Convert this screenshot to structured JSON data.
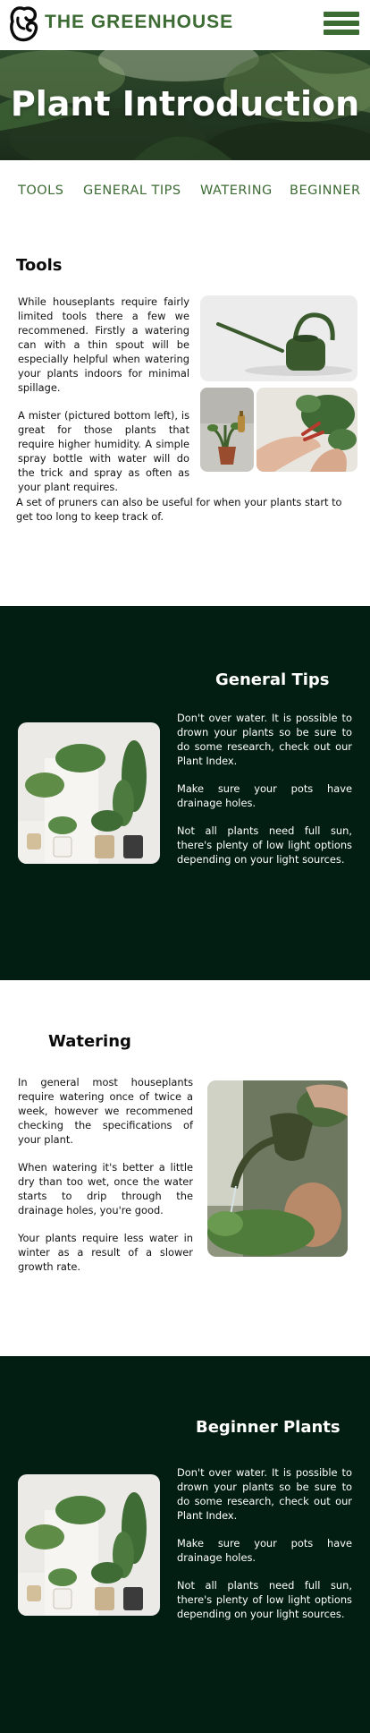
{
  "header": {
    "brand": "THE GREENHOUSE",
    "logo_icon": "greenhouse-logo-icon",
    "menu_icon": "hamburger-menu-icon"
  },
  "hero": {
    "title": "Plant Introduction"
  },
  "nav": {
    "items": [
      {
        "label": "TOOLS"
      },
      {
        "label": "GENERAL TIPS"
      },
      {
        "label": "WATERING"
      },
      {
        "label": "BEGINNER"
      }
    ]
  },
  "tools": {
    "title": "Tools",
    "paragraphs": [
      "While houseplants require fairly limited tools there a few we recommened. Firstly a watering can with a thin spout will be especially helpful when watering your plants indoors for minimal spillage.",
      "A mister (pictured bottom left), is great for those plants that require higher humidity. A simple spray bottle with water will do the trick and spray as often as your plant requires.",
      "A set of pruners can also be useful for when your plants start to get too long to keep track of."
    ]
  },
  "general_tips": {
    "title": "General Tips",
    "paragraphs": [
      "Don't over water. It is possible to drown your plants so be sure to do some research, check out our Plant Index.",
      "Make sure your pots have drainage holes.",
      "Not all plants need full sun, there's plenty of low light options depending on your light sources."
    ]
  },
  "watering": {
    "title": "Watering",
    "paragraphs": [
      "In general most houseplants require watering once of twice a week, however we recommened checking the specifications of your plant.",
      "When watering it's better a little dry than too wet, once the water starts to drip through the drainage holes, you're good.",
      "Your plants require less water in winter as a result of a slower growth rate."
    ]
  },
  "beginner": {
    "title": "Beginner Plants",
    "paragraphs": [
      "Don't over water. It is possible to drown your plants so be sure to do some research, check out our Plant Index.",
      "Make sure your pots have drainage holes.",
      "Not all plants need full sun, there's plenty of low light options depending on your light sources."
    ]
  },
  "colors": {
    "brand_green": "#3d6b34",
    "dark_section": "#021d12",
    "white": "#ffffff"
  }
}
